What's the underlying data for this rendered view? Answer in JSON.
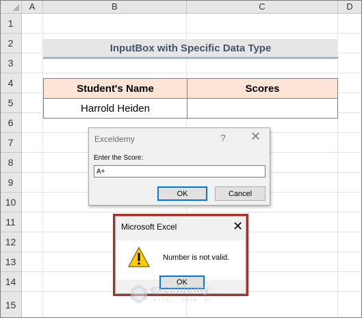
{
  "columns": [
    "A",
    "B",
    "C",
    "D"
  ],
  "rows": [
    "1",
    "2",
    "3",
    "4",
    "5",
    "6",
    "7",
    "8",
    "9",
    "10",
    "11",
    "12",
    "13",
    "14",
    "15"
  ],
  "sheet": {
    "title": "InputBox with Specific Data Type",
    "headers": {
      "name": "Student's Name",
      "scores": "Scores"
    },
    "row5": {
      "name": "Harrold Heiden",
      "score": ""
    }
  },
  "input_dialog": {
    "title": "Exceldemy",
    "help_glyph": "?",
    "close_glyph": "✕",
    "prompt": "Enter the Score:",
    "value": "A+",
    "ok_label": "OK",
    "cancel_label": "Cancel"
  },
  "message_box": {
    "title": "Microsoft Excel",
    "close_glyph": "✕",
    "message": "Number is not valid.",
    "ok_label": "OK",
    "icon": "warning-icon"
  },
  "watermark": {
    "name": "exceldemy",
    "tagline": "EXCEL · DATA · BI"
  },
  "colors": {
    "title_fill": "#e7e6e6",
    "title_text": "#44546a",
    "header_fill": "#fce4d6",
    "highlight_border": "#a4322e",
    "default_button_border": "#0078d7"
  }
}
